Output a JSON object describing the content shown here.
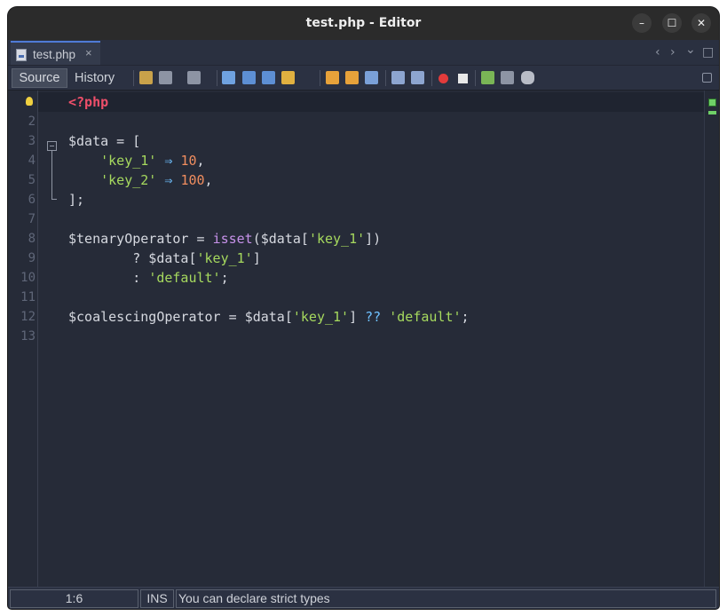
{
  "window": {
    "title": "test.php - Editor",
    "minimize_icon": "–",
    "maximize_icon": "☐",
    "close_icon": "✕"
  },
  "tabs": {
    "active": {
      "label": "test.php",
      "close": "×"
    },
    "nav_left": "‹",
    "nav_right": "›",
    "nav_dropdown": "⌄",
    "nav_maximize": "□"
  },
  "toolbar": {
    "source_label": "Source",
    "history_label": "History"
  },
  "line_numbers": [
    "1",
    "2",
    "3",
    "4",
    "5",
    "6",
    "7",
    "8",
    "9",
    "10",
    "11",
    "12",
    "13"
  ],
  "code": {
    "l1_open": "<?php",
    "l3_var": "$data",
    "l3_rest": " = [",
    "l4_indent": "    ",
    "l4_key": "'key_1'",
    "l4_arrow": " ⇒ ",
    "l4_val": "10",
    "l4_tail": ",",
    "l5_indent": "    ",
    "l5_key": "'key_2'",
    "l5_arrow": " ⇒ ",
    "l5_val": "100",
    "l5_tail": ",",
    "l6": "];",
    "l8_var": "$tenaryOperator",
    "l8_eq": " = ",
    "l8_fn": "isset",
    "l8_open": "($data[",
    "l8_key": "'key_1'",
    "l8_close": "])",
    "l9_pre": "        ? $data[",
    "l9_key": "'key_1'",
    "l9_close": "]",
    "l10_pre": "        : ",
    "l10_str": "'default'",
    "l10_tail": ";",
    "l12_var": "$coalescingOperator",
    "l12_eq": " = ",
    "l12_data": "$data[",
    "l12_key": "'key_1'",
    "l12_close": "] ",
    "l12_op": "??",
    "l12_sp": " ",
    "l12_str": "'default'",
    "l12_tail": ";"
  },
  "status": {
    "position": "1:6",
    "mode": "INS",
    "message": "You can declare strict types"
  },
  "colors": {
    "php_tag": "#ef4f6a",
    "string": "#a6d95e",
    "number": "#f08d5f",
    "operator": "#6fc0ff",
    "function": "#c792ea"
  }
}
